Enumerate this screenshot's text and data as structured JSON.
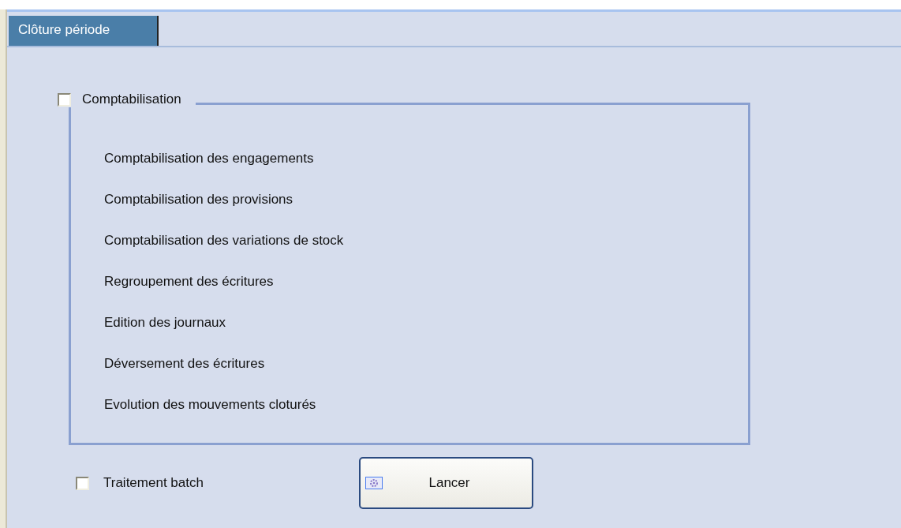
{
  "tabs": [
    {
      "label": "Clôture période",
      "selected": true
    }
  ],
  "group": {
    "label": "Comptabilisation",
    "checked": false,
    "items": [
      "Comptabilisation des engagements",
      "Comptabilisation des provisions",
      "Comptabilisation des variations de stock",
      "Regroupement des écritures",
      "Edition des journaux",
      "Déversement des écritures",
      "Evolution des mouvements cloturés"
    ]
  },
  "batch": {
    "label": "Traitement batch",
    "checked": false
  },
  "launch_button": {
    "label": "Lancer"
  }
}
